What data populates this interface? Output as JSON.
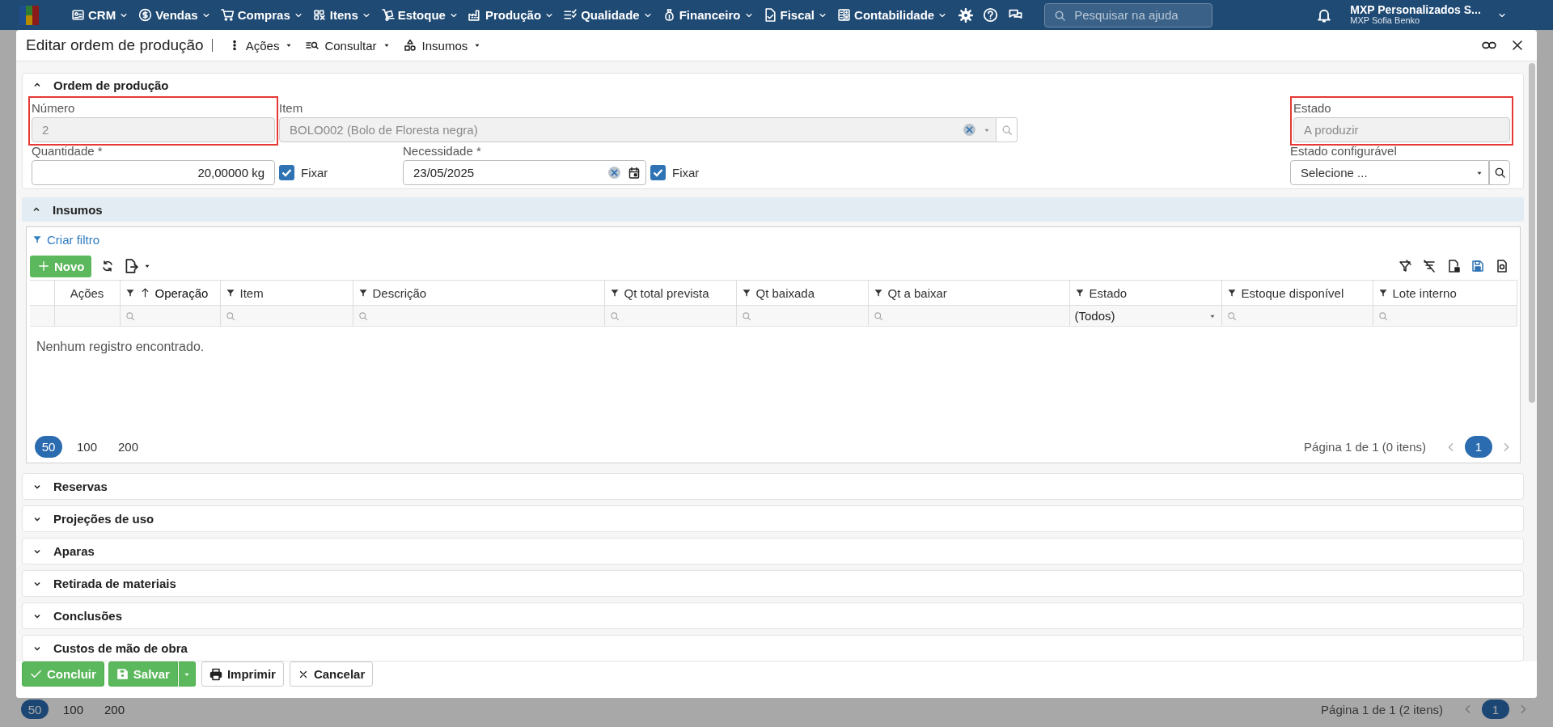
{
  "app_bar": {
    "menus": [
      {
        "label": "CRM"
      },
      {
        "label": "Vendas"
      },
      {
        "label": "Compras"
      },
      {
        "label": "Itens"
      },
      {
        "label": "Estoque"
      },
      {
        "label": "Produção"
      },
      {
        "label": "Qualidade"
      },
      {
        "label": "Financeiro"
      },
      {
        "label": "Fiscal"
      },
      {
        "label": "Contabilidade"
      }
    ],
    "search": {
      "placeholder": "Pesquisar na ajuda"
    },
    "company": "MXP Personalizados S...",
    "user": "MXP Sofia Benko"
  },
  "background_pager": {
    "page_sizes": [
      {
        "label": "50",
        "selected": true
      },
      {
        "label": "100",
        "selected": false
      },
      {
        "label": "200",
        "selected": false
      }
    ],
    "summary": "Página 1 de 1 (2 itens)",
    "pages": [
      {
        "label": "1",
        "selected": true
      }
    ]
  },
  "dialog": {
    "title": "Editar ordem de produção",
    "menus": [
      {
        "label": "Ações"
      },
      {
        "label": "Consultar"
      },
      {
        "label": "Insumos"
      }
    ]
  },
  "order": {
    "title": "Ordem de produção",
    "expanded": true,
    "number": {
      "label": "Número",
      "value": "2",
      "disabled": true,
      "highlighted": true
    },
    "item": {
      "label": "Item",
      "value": "BOLO002 (Bolo de Floresta negra)",
      "disabled": true
    },
    "status": {
      "label": "Estado",
      "value": "A produzir",
      "disabled": true,
      "highlighted": true
    },
    "quantity": {
      "label": "Quantidade *",
      "value": "20,00000 kg",
      "fix": {
        "label": "Fixar",
        "checked": true
      }
    },
    "need_date": {
      "label": "Necessidade *",
      "value": "23/05/2025",
      "fix": {
        "label": "Fixar",
        "checked": true
      }
    },
    "configurable_status": {
      "label": "Estado configurável",
      "placeholder": "Selecione ..."
    }
  },
  "inputs": {
    "title": "Insumos",
    "expanded": true,
    "filter_link": "Criar filtro",
    "new_button": "Novo",
    "columns": [
      {
        "label": "Ações",
        "filterable": false,
        "sorted": false
      },
      {
        "label": "Operação",
        "filterable": true,
        "sorted": true
      },
      {
        "label": "Item",
        "filterable": true,
        "sorted": false
      },
      {
        "label": "Descrição",
        "filterable": true,
        "sorted": false
      },
      {
        "label": "Qt total prevista",
        "filterable": true,
        "sorted": false
      },
      {
        "label": "Qt baixada",
        "filterable": true,
        "sorted": false
      },
      {
        "label": "Qt a baixar",
        "filterable": true,
        "sorted": false
      },
      {
        "label": "Estado",
        "filterable": true,
        "sorted": false,
        "filter_value": "(Todos)"
      },
      {
        "label": "Estoque disponível",
        "filterable": true,
        "sorted": false
      },
      {
        "label": "Lote interno",
        "filterable": true,
        "sorted": false
      }
    ],
    "empty_message": "Nenhum registro encontrado.",
    "pager": {
      "page_sizes": [
        {
          "label": "50",
          "selected": true
        },
        {
          "label": "100",
          "selected": false
        },
        {
          "label": "200",
          "selected": false
        }
      ],
      "summary": "Página 1 de 1 (0 itens)",
      "pages": [
        {
          "label": "1",
          "selected": true
        }
      ]
    }
  },
  "sections": [
    {
      "title": "Reservas",
      "expanded": false
    },
    {
      "title": "Projeções de uso",
      "expanded": false
    },
    {
      "title": "Aparas",
      "expanded": false
    },
    {
      "title": "Retirada de materiais",
      "expanded": false
    },
    {
      "title": "Conclusões",
      "expanded": false
    },
    {
      "title": "Custos de mão de obra",
      "expanded": false
    }
  ],
  "footer": {
    "buttons": [
      {
        "label": "Concluir",
        "kind": "primary"
      },
      {
        "label": "Salvar",
        "kind": "split"
      },
      {
        "label": "Imprimir",
        "kind": "default"
      },
      {
        "label": "Cancelar",
        "kind": "default"
      }
    ]
  }
}
